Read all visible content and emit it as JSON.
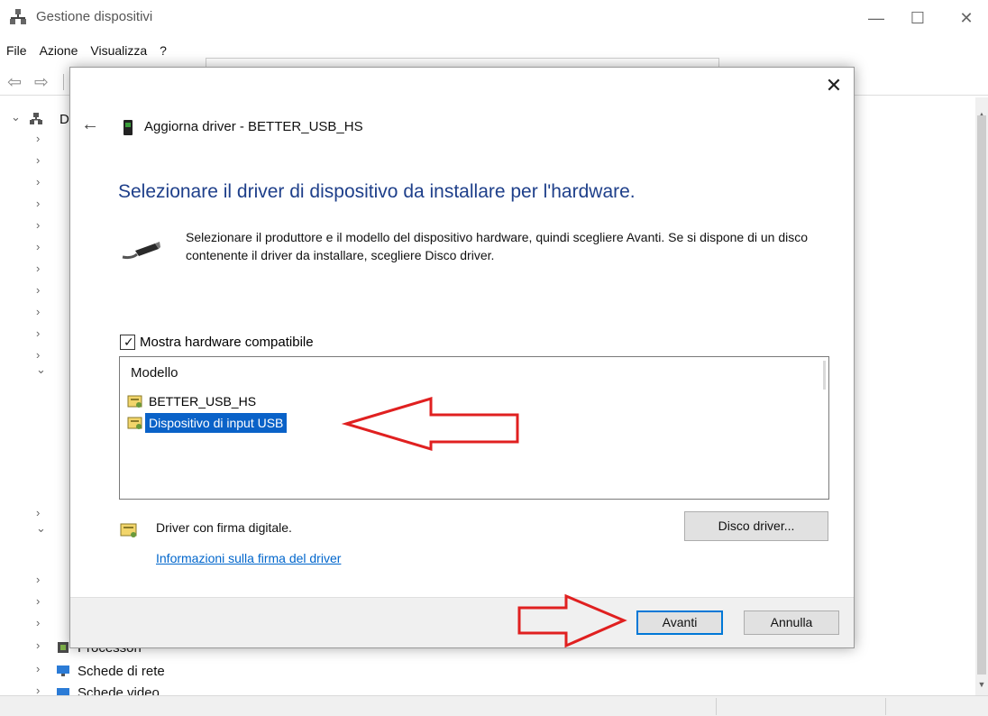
{
  "window": {
    "title": "Gestione dispositivi",
    "controls": {
      "minimize": "—",
      "maximize": "☐",
      "close": "✕"
    }
  },
  "menu": [
    "File",
    "Azione",
    "Visualizza",
    "?"
  ],
  "tree": {
    "root_partial": "D",
    "visible_items": [
      "Processori",
      "Schede di rete",
      "Schede video"
    ]
  },
  "dialog": {
    "close_glyph": "✕",
    "back_glyph": "←",
    "title": "Aggiorna driver - BETTER_USB_HS",
    "heading": "Selezionare il driver di dispositivo da installare per l'hardware.",
    "instructions": "Selezionare il produttore e il modello del dispositivo hardware, quindi scegliere Avanti. Se si dispone di un disco contenente il driver da installare, scegliere Disco driver.",
    "show_compatible": {
      "label": "Mostra hardware compatibile",
      "checked": true
    },
    "list": {
      "header": "Modello",
      "items": [
        "BETTER_USB_HS",
        "Dispositivo di input USB"
      ],
      "selected_index": 1
    },
    "signed_text": "Driver con firma digitale.",
    "disk_button": "Disco driver...",
    "signature_link": "Informazioni sulla firma del driver",
    "next_button": "Avanti",
    "cancel_button": "Annulla"
  },
  "colors": {
    "heading": "#1e3f8a",
    "selection": "#0a62c8",
    "link": "#0066cc",
    "annotation_arrow": "#e02020",
    "default_button_border": "#0078d7"
  }
}
